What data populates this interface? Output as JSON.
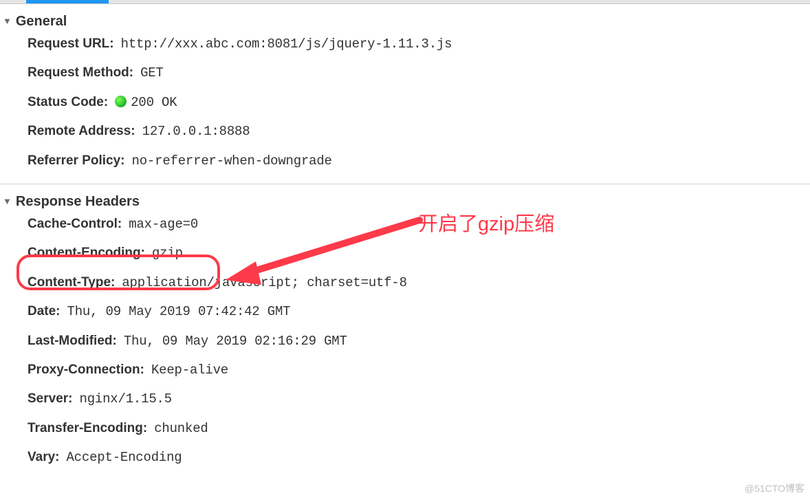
{
  "sections": {
    "general": {
      "title": "General",
      "rows": [
        {
          "key": "Request URL:",
          "value": "http://xxx.abc.com:8081/js/jquery-1.11.3.js"
        },
        {
          "key": "Request Method:",
          "value": "GET"
        },
        {
          "key": "Status Code:",
          "value": "200 OK",
          "status": true
        },
        {
          "key": "Remote Address:",
          "value": "127.0.0.1:8888"
        },
        {
          "key": "Referrer Policy:",
          "value": "no-referrer-when-downgrade"
        }
      ]
    },
    "responseHeaders": {
      "title": "Response Headers",
      "rows": [
        {
          "key": "Cache-Control:",
          "value": "max-age=0"
        },
        {
          "key": "Content-Encoding:",
          "value": "gzip",
          "highlighted": true
        },
        {
          "key": "Content-Type:",
          "value": "application/javascript; charset=utf-8"
        },
        {
          "key": "Date:",
          "value": "Thu, 09 May 2019 07:42:42 GMT"
        },
        {
          "key": "Last-Modified:",
          "value": "Thu, 09 May 2019 02:16:29 GMT"
        },
        {
          "key": "Proxy-Connection:",
          "value": "Keep-alive"
        },
        {
          "key": "Server:",
          "value": "nginx/1.15.5"
        },
        {
          "key": "Transfer-Encoding:",
          "value": "chunked"
        },
        {
          "key": "Vary:",
          "value": "Accept-Encoding"
        }
      ]
    }
  },
  "annotation": "开启了gzip压缩",
  "watermark": "@51CTO博客"
}
